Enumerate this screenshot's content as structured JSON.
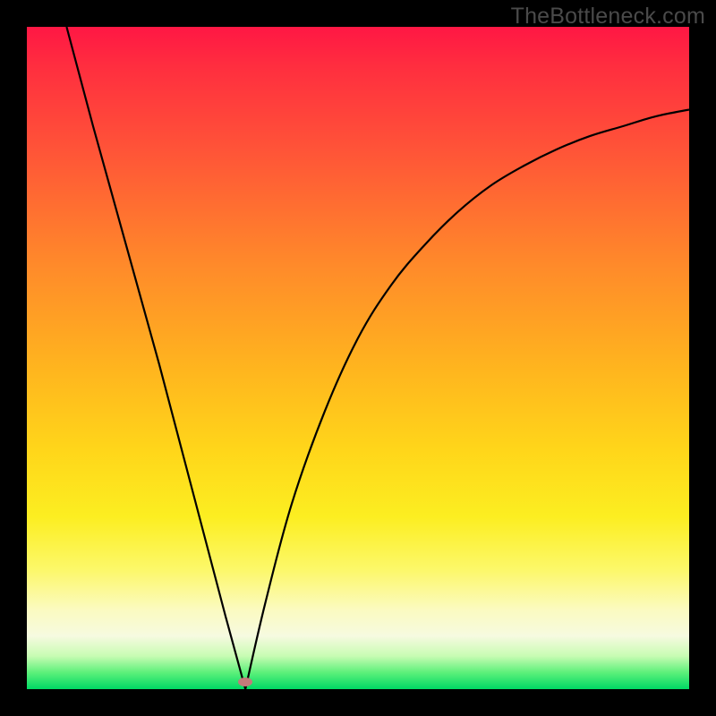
{
  "watermark": "TheBottleneck.com",
  "chart_data": {
    "type": "line",
    "title": "",
    "xlabel": "",
    "ylabel": "",
    "xlim": [
      0,
      100
    ],
    "ylim": [
      0,
      100
    ],
    "curve": {
      "name": "bottleneck-v",
      "min_x": 33,
      "points": [
        {
          "x": 6,
          "y": 100
        },
        {
          "x": 10,
          "y": 85
        },
        {
          "x": 15,
          "y": 67
        },
        {
          "x": 20,
          "y": 49
        },
        {
          "x": 25,
          "y": 30
        },
        {
          "x": 30,
          "y": 11
        },
        {
          "x": 33,
          "y": 0
        },
        {
          "x": 36,
          "y": 13
        },
        {
          "x": 40,
          "y": 28
        },
        {
          "x": 45,
          "y": 42
        },
        {
          "x": 50,
          "y": 53
        },
        {
          "x": 55,
          "y": 61
        },
        {
          "x": 60,
          "y": 67
        },
        {
          "x": 65,
          "y": 72
        },
        {
          "x": 70,
          "y": 76
        },
        {
          "x": 75,
          "y": 79
        },
        {
          "x": 80,
          "y": 81.5
        },
        {
          "x": 85,
          "y": 83.5
        },
        {
          "x": 90,
          "y": 85
        },
        {
          "x": 95,
          "y": 86.5
        },
        {
          "x": 100,
          "y": 87.5
        }
      ]
    },
    "min_marker": {
      "x": 33,
      "y": 0,
      "color": "#c47a7a"
    },
    "background_gradient": [
      "#ff1744",
      "#ff8a2a",
      "#fcee21",
      "#fbfac0",
      "#00d964"
    ]
  }
}
